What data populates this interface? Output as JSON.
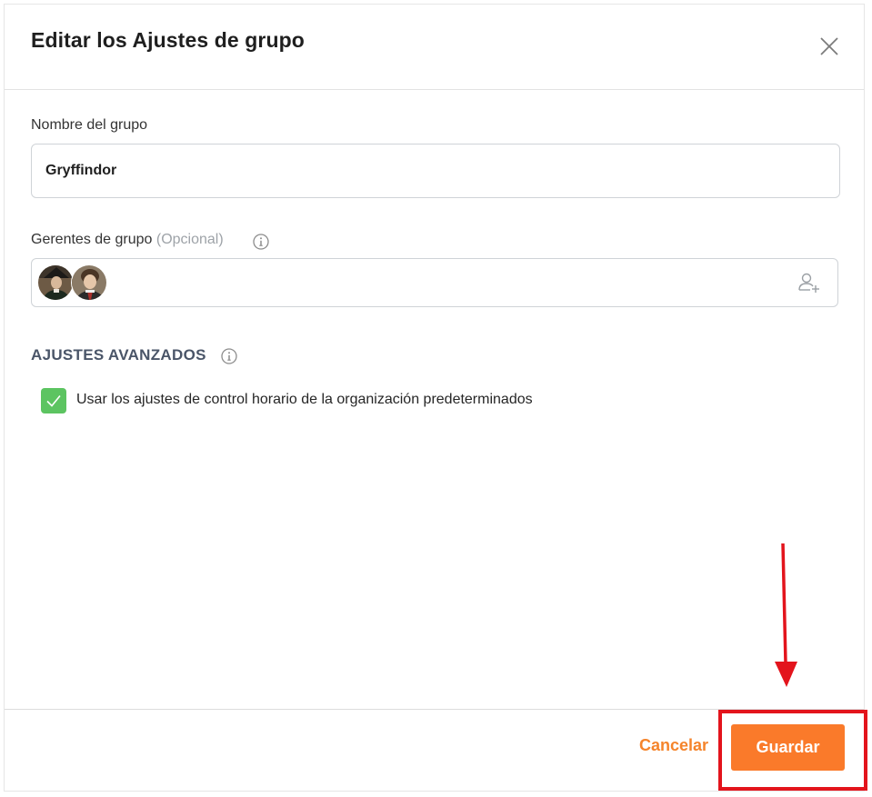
{
  "dialog": {
    "title": "Editar los Ajustes de grupo"
  },
  "group_name": {
    "label": "Nombre del grupo",
    "value": "Gryffindor"
  },
  "managers": {
    "label": "Gerentes de grupo",
    "optional_label": "(Opcional)",
    "avatars": [
      "manager-avatar-1",
      "manager-avatar-2"
    ]
  },
  "advanced": {
    "title": "AJUSTES AVANZADOS",
    "checkbox_label": "Usar los ajustes de control horario de la organización predeterminados",
    "checkbox_checked": true
  },
  "footer": {
    "cancel_label": "Cancelar",
    "save_label": "Guardar"
  },
  "colors": {
    "accent_orange": "#fa7a2a",
    "checkbox_green": "#5cc461",
    "annotation_red": "#e3141c"
  },
  "icons": {
    "close": "close-icon",
    "info": "info-icon",
    "add_user": "add-user-icon",
    "check": "check-icon"
  }
}
